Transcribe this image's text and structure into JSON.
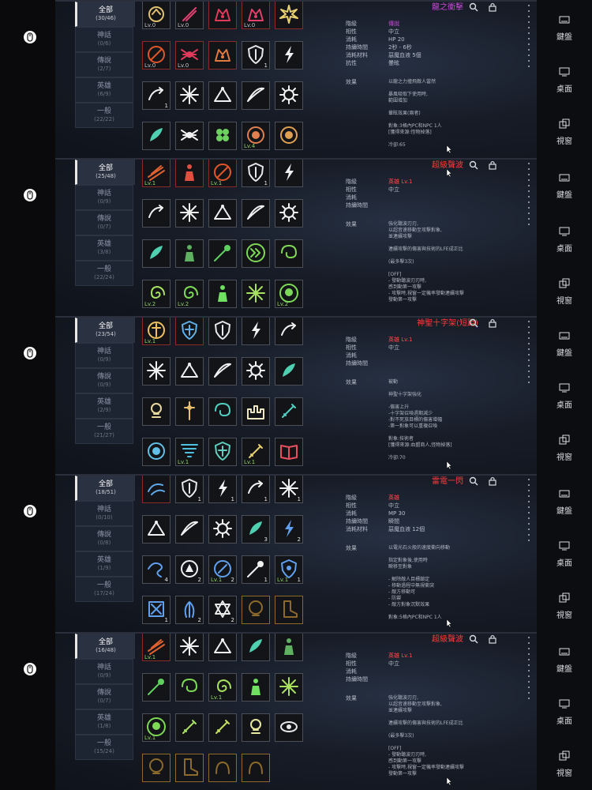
{
  "right_menu": [
    {
      "label": "鍵盤",
      "icon": "keyboard-icon"
    },
    {
      "label": "桌面",
      "icon": "desktop-icon"
    },
    {
      "label": "視窗",
      "icon": "windows-icon"
    }
  ],
  "left_icons": [
    "mouse-icon",
    "mouse-icon",
    "mouse-icon",
    "mouse-icon",
    "mouse-icon"
  ],
  "panels": [
    {
      "tabs": [
        {
          "name": "全部",
          "count": "(30/46)"
        },
        {
          "name": "神話",
          "count": "(0/6)"
        },
        {
          "name": "傳說",
          "count": "(2/7)"
        },
        {
          "name": "英雄",
          "count": "(6/9)"
        },
        {
          "name": "一般",
          "count": "(22/22)"
        }
      ],
      "cells": [
        {
          "icon": "arrow-swirl",
          "color": "#e0c070",
          "lv": "Lv.0",
          "lvgrey": true
        },
        {
          "icon": "slash",
          "color": "#e04070",
          "lv": "Lv.0",
          "lvgrey": true
        },
        {
          "icon": "beast",
          "color": "#e03a5a",
          "lv": "",
          "hl": true
        },
        {
          "icon": "beast",
          "color": "#e0406a",
          "lv": "Lv.0",
          "lvgrey": true,
          "hl": true
        },
        {
          "icon": "burst",
          "color": "#e8d070",
          "lv": "",
          "hl": true
        },
        {
          "icon": "circle-slash",
          "color": "#e0562a",
          "lv": "Lv.0",
          "lvgrey": true,
          "hl": true
        },
        {
          "icon": "spider",
          "color": "#e03a5a",
          "lv": "Lv.0",
          "lvgrey": true,
          "hl": true
        },
        {
          "icon": "beast",
          "color": "#e07a40",
          "lv": "",
          "hl": true
        },
        {
          "icon": "shield",
          "color": "#e8e8e8",
          "lv": "",
          "count": "1"
        },
        {
          "icon": "lightning",
          "color": "#f0f0f0",
          "lv": ""
        },
        {
          "icon": "arc-arrow",
          "color": "#f0f0f0",
          "lv": "",
          "count": "1"
        },
        {
          "icon": "star-burst",
          "color": "#f0f0f0",
          "lv": ""
        },
        {
          "icon": "pyramid",
          "color": "#f0f0f0",
          "lv": ""
        },
        {
          "icon": "eye-blade",
          "color": "#f0f0f0",
          "lv": ""
        },
        {
          "icon": "gear",
          "color": "#f0f0f0",
          "lv": ""
        },
        {
          "icon": "feather",
          "color": "#4fd0b0",
          "lv": ""
        },
        {
          "icon": "spider",
          "color": "#f0f0f0",
          "lv": ""
        },
        {
          "icon": "clover",
          "color": "#6ed060",
          "lv": ""
        },
        {
          "icon": "blossom",
          "color": "#e08050",
          "lv": "Lv.4"
        },
        {
          "icon": "blossom",
          "color": "#e0a050",
          "lv": ""
        }
      ],
      "detail": {
        "title": "龍之衝擊",
        "title_color": "purple",
        "rows": [
          {
            "k": "階級",
            "v": "傳說",
            "vc": "purple"
          },
          {
            "k": "相性",
            "v": "中立"
          },
          {
            "k": "消耗",
            "v": "HP 20"
          },
          {
            "k": "持續時間",
            "v": "2秒 - 6秒"
          },
          {
            "k": "消耗材料",
            "v": "惡魔血液 5個"
          },
          {
            "k": "抗性",
            "v": "暈眩"
          }
        ],
        "effect_label": "效果",
        "desc": [
          "以龍之力撞飛敵人當然",
          "",
          "暴風吸取下使用時,",
          "範圍增加",
          "",
          "暈眩效果(兩者)",
          "",
          "對象:3格內PC和NPC 1人",
          "[獲得來源:怪物掉落]",
          "",
          "冷卻:65"
        ]
      }
    },
    {
      "tabs": [
        {
          "name": "全部",
          "count": "(25/48)"
        },
        {
          "name": "神話",
          "count": "(0/9)"
        },
        {
          "name": "傳說",
          "count": "(0/7)"
        },
        {
          "name": "英雄",
          "count": "(3/8)"
        },
        {
          "name": "一般",
          "count": "(22/24)"
        }
      ],
      "cells": [
        {
          "icon": "claw",
          "color": "#e06030",
          "lv": "Lv.1",
          "hl": true
        },
        {
          "icon": "figure",
          "color": "#e05040",
          "lv": "",
          "hl": true
        },
        {
          "icon": "circle-slash",
          "color": "#e0562a",
          "lv": "Lv.1",
          "hl": true
        },
        {
          "icon": "shield",
          "color": "#e8e8e8",
          "lv": "",
          "count": "1"
        },
        {
          "icon": "lightning",
          "color": "#f0f0f0",
          "lv": ""
        },
        {
          "icon": "arc-arrow",
          "color": "#f0f0f0",
          "lv": ""
        },
        {
          "icon": "star-burst",
          "color": "#f0f0f0",
          "lv": ""
        },
        {
          "icon": "pyramid",
          "color": "#f0f0f0",
          "lv": ""
        },
        {
          "icon": "eye-blade",
          "color": "#f0f0f0",
          "lv": ""
        },
        {
          "icon": "gear",
          "color": "#f0f0f0",
          "lv": ""
        },
        {
          "icon": "feather",
          "color": "#4fd0b0",
          "lv": ""
        },
        {
          "icon": "figure",
          "color": "#5fb060",
          "lv": ""
        },
        {
          "icon": "comet",
          "color": "#5fd060",
          "lv": ""
        },
        {
          "icon": "double-chevron",
          "color": "#7ed957",
          "lv": ""
        },
        {
          "icon": "swirl",
          "color": "#7ed957",
          "lv": ""
        },
        {
          "icon": "spiral",
          "color": "#a8e060",
          "lv": "Lv.2"
        },
        {
          "icon": "spiral",
          "color": "#7ed957",
          "lv": "Lv.2"
        },
        {
          "icon": "figure",
          "color": "#6fe060",
          "lv": ""
        },
        {
          "icon": "star-burst",
          "color": "#a8e060",
          "lv": ""
        },
        {
          "icon": "skull-ring",
          "color": "#7ed957",
          "lv": "Lv.2"
        }
      ],
      "detail": {
        "title": "超級聲波",
        "title_color": "red",
        "rows": [
          {
            "k": "階級",
            "v": "英雄 Lv.1",
            "vc": "red"
          },
          {
            "k": "相性",
            "v": "中立"
          },
          {
            "k": "消耗",
            "v": ""
          },
          {
            "k": "持續時間",
            "v": ""
          }
        ],
        "effect_label": "效果",
        "desc": [
          "強化聽波刃刃,",
          "以超音速移動至攻擊對象,",
          "並連續攻擊",
          "",
          "連續攻擊的傷害與技術的LFE成正比",
          "",
          "(最多擊3次)",
          "",
          "[OFF]",
          "- 發動聽波刃刃時,",
          "  感到動第一攻擊",
          "- 攻擊時,視窗一定機率發動連續攻擊",
          "  發動第一攻擊"
        ]
      }
    },
    {
      "tabs": [
        {
          "name": "全部",
          "count": "(23/54)"
        },
        {
          "name": "神話",
          "count": "(0/9)"
        },
        {
          "name": "傳說",
          "count": "(0/9)"
        },
        {
          "name": "英雄",
          "count": "(2/9)"
        },
        {
          "name": "一般",
          "count": "(21/27)"
        }
      ],
      "cells": [
        {
          "icon": "cross-sun",
          "color": "#f0c060",
          "lv": "Lv.1",
          "hl": true
        },
        {
          "icon": "shield-cross",
          "color": "#5fb0e8",
          "lv": "",
          "hl": true
        },
        {
          "icon": "shield",
          "color": "#e8e8e8",
          "lv": ""
        },
        {
          "icon": "lightning",
          "color": "#f0f0f0",
          "lv": ""
        },
        {
          "icon": "arc-arrow",
          "color": "#f0f0f0",
          "lv": ""
        },
        {
          "icon": "star-burst",
          "color": "#f0f0f0",
          "lv": ""
        },
        {
          "icon": "pyramid",
          "color": "#f0f0f0",
          "lv": ""
        },
        {
          "icon": "eye-blade",
          "color": "#f0f0f0",
          "lv": ""
        },
        {
          "icon": "gear",
          "color": "#f0f0f0",
          "lv": ""
        },
        {
          "icon": "feather",
          "color": "#4fd0b0",
          "lv": ""
        },
        {
          "icon": "orb",
          "color": "#e8d8a0",
          "lv": ""
        },
        {
          "icon": "cross",
          "color": "#e8c070",
          "lv": ""
        },
        {
          "icon": "swirl",
          "color": "#4fd0c0",
          "lv": ""
        },
        {
          "icon": "castle",
          "color": "#f0e8c0",
          "lv": ""
        },
        {
          "icon": "sword",
          "color": "#4fd0c0",
          "lv": ""
        },
        {
          "icon": "sun",
          "color": "#5fc0e8",
          "lv": ""
        },
        {
          "icon": "tornado",
          "color": "#4fc0e0",
          "lv": "Lv.1"
        },
        {
          "icon": "shield-cross",
          "color": "#5fd0c0",
          "lv": ""
        },
        {
          "icon": "sword",
          "color": "#e8d070",
          "lv": "Lv.1"
        },
        {
          "icon": "book",
          "color": "#e85060",
          "lv": ""
        }
      ],
      "detail": {
        "title": "神聖十字架(短距)",
        "title_color": "red",
        "rows": [
          {
            "k": "階級",
            "v": "英雄 Lv.1",
            "vc": "red"
          },
          {
            "k": "相性",
            "v": "中立"
          },
          {
            "k": "消耗",
            "v": ""
          },
          {
            "k": "持續時間",
            "v": ""
          }
        ],
        "effect_label": "效果",
        "desc": [
          "被動",
          "",
          "神聖十字架強化",
          "",
          "-傷害上升",
          "-十字架召喚週期減少",
          "-對不死族目標的傷害增幅",
          "-第一對象可以重複召喚",
          "",
          "對象:技術者",
          "[獲得來源:血盟商人,怪物掉落]",
          "",
          "冷卻:70"
        ]
      }
    },
    {
      "tabs": [
        {
          "name": "全部",
          "count": "(18/51)"
        },
        {
          "name": "神話",
          "count": "(0/10)"
        },
        {
          "name": "傳說",
          "count": "(0/8)"
        },
        {
          "name": "英雄",
          "count": "(1/9)"
        },
        {
          "name": "一般",
          "count": "(17/24)"
        }
      ],
      "cells": [
        {
          "icon": "lightning-swirl",
          "color": "#5fa8e8",
          "lv": "",
          "hl": true
        },
        {
          "icon": "shield",
          "color": "#e8e8e8",
          "lv": "",
          "count": "1"
        },
        {
          "icon": "lightning",
          "color": "#f0f0f0",
          "lv": "",
          "count": "1"
        },
        {
          "icon": "arc-arrow",
          "color": "#f0f0f0",
          "lv": "",
          "count": "1"
        },
        {
          "icon": "star-burst",
          "color": "#f0f0f0",
          "lv": "",
          "count": "1"
        },
        {
          "icon": "pyramid",
          "color": "#f0f0f0",
          "lv": ""
        },
        {
          "icon": "eye-blade",
          "color": "#f0f0f0",
          "lv": ""
        },
        {
          "icon": "gear",
          "color": "#f0f0f0",
          "lv": ""
        },
        {
          "icon": "feather",
          "color": "#4fd0b0",
          "lv": "",
          "count": "3"
        },
        {
          "icon": "lightning",
          "color": "#5fa0f0",
          "lv": "",
          "count": "2"
        },
        {
          "icon": "dragon",
          "color": "#5fa0f0",
          "lv": "",
          "count": "4"
        },
        {
          "icon": "orbit",
          "color": "#f0f0f0",
          "lv": "",
          "count": "2"
        },
        {
          "icon": "sun-ring",
          "color": "#5fa0f0",
          "lv": "Lv.1",
          "count": "2"
        },
        {
          "icon": "comet",
          "color": "#f0f0f0",
          "lv": "",
          "count": "1"
        },
        {
          "icon": "shield-burst",
          "color": "#5fa0f0",
          "lv": "Lv.1",
          "count": "1"
        },
        {
          "icon": "portal",
          "color": "#5fa0f0",
          "lv": "",
          "count": "1"
        },
        {
          "icon": "wings",
          "color": "#5fa0f0",
          "lv": "",
          "count": "2"
        },
        {
          "icon": "star-of-david",
          "color": "#e8e8e8",
          "lv": "",
          "count": "2"
        },
        {
          "icon": "skull",
          "color": "#8c6a2c",
          "lv": "",
          "gold": true
        },
        {
          "icon": "boot",
          "color": "#8c6a2c",
          "lv": "",
          "gold": true
        }
      ],
      "detail": {
        "title": "雷電一閃",
        "title_color": "red",
        "rows": [
          {
            "k": "階級",
            "v": "英雄",
            "vc": "red"
          },
          {
            "k": "相性",
            "v": "中立"
          },
          {
            "k": "消耗",
            "v": "MP 30"
          },
          {
            "k": "持續時間",
            "v": "瞬間"
          },
          {
            "k": "消耗材料",
            "v": "惡魔血液 12個"
          }
        ],
        "effect_label": "效果",
        "desc": [
          "以電光石火般的速度衝向移動",
          "",
          "指定對象後,使用時",
          "瞬移至對象",
          "",
          "- 解除敵人目標鎖定",
          "- 移動過程中無視衝突",
          "- 敵方移動可",
          "- 防禦",
          "- 敵方對象沉默效果",
          "",
          "對象:5格內PC和NPC 1人"
        ]
      }
    },
    {
      "tabs": [
        {
          "name": "全部",
          "count": "(16/48)"
        },
        {
          "name": "神話",
          "count": "(0/9)"
        },
        {
          "name": "傳說",
          "count": "(0/7)"
        },
        {
          "name": "英雄",
          "count": "(1/8)"
        },
        {
          "name": "一般",
          "count": "(15/24)"
        }
      ],
      "cells": [
        {
          "icon": "claw",
          "color": "#e06030",
          "lv": "Lv.1",
          "hl": true
        },
        {
          "icon": "star-burst",
          "color": "#f0f0f0",
          "lv": ""
        },
        {
          "icon": "pyramid",
          "color": "#f0f0f0",
          "lv": ""
        },
        {
          "icon": "feather",
          "color": "#4fd0b0",
          "lv": ""
        },
        {
          "icon": "figure",
          "color": "#5fb060",
          "lv": ""
        },
        {
          "icon": "comet",
          "color": "#5fd060",
          "lv": ""
        },
        {
          "icon": "swirl",
          "color": "#7ed957",
          "lv": ""
        },
        {
          "icon": "spiral",
          "color": "#a8e060",
          "lv": "Lv.1"
        },
        {
          "icon": "figure",
          "color": "#6fe060",
          "lv": ""
        },
        {
          "icon": "star-burst",
          "color": "#a8e060",
          "lv": ""
        },
        {
          "icon": "skull-ring",
          "color": "#7ed957",
          "lv": "Lv.1"
        },
        {
          "icon": "sword",
          "color": "#a8e060",
          "lv": ""
        },
        {
          "icon": "sword",
          "color": "#c8e060",
          "lv": ""
        },
        {
          "icon": "orb",
          "color": "#e8e8a0",
          "lv": ""
        },
        {
          "icon": "eye",
          "color": "#e8e8e8",
          "lv": ""
        },
        {
          "icon": "skull",
          "color": "#8c6a2c",
          "lv": "",
          "gold": true
        },
        {
          "icon": "boot",
          "color": "#8c6a2c",
          "lv": "",
          "gold": true
        },
        {
          "icon": "horn",
          "color": "#8c6a2c",
          "lv": "",
          "gold": true
        },
        {
          "icon": "horn",
          "color": "#8c6a2c",
          "lv": "",
          "gold": true
        }
      ],
      "detail": {
        "title": "超級聲波",
        "title_color": "red",
        "rows": [
          {
            "k": "階級",
            "v": "英雄 Lv.1",
            "vc": "red"
          },
          {
            "k": "相性",
            "v": "中立"
          },
          {
            "k": "消耗",
            "v": ""
          },
          {
            "k": "持續時間",
            "v": ""
          }
        ],
        "effect_label": "效果",
        "desc": [
          "強化聽波刃刃,",
          "以超音速移動至攻擊對象,",
          "並連續攻擊",
          "",
          "連續攻擊的傷害與技術的LFE成正比",
          "",
          "(最多擊3次)",
          "",
          "[OFF]",
          "- 發動聽波刃刃時,",
          "  感到動第一攻擊",
          "- 攻擊時,視窗一定機率發動連續攻擊",
          "  發動第一攻擊"
        ]
      }
    }
  ]
}
